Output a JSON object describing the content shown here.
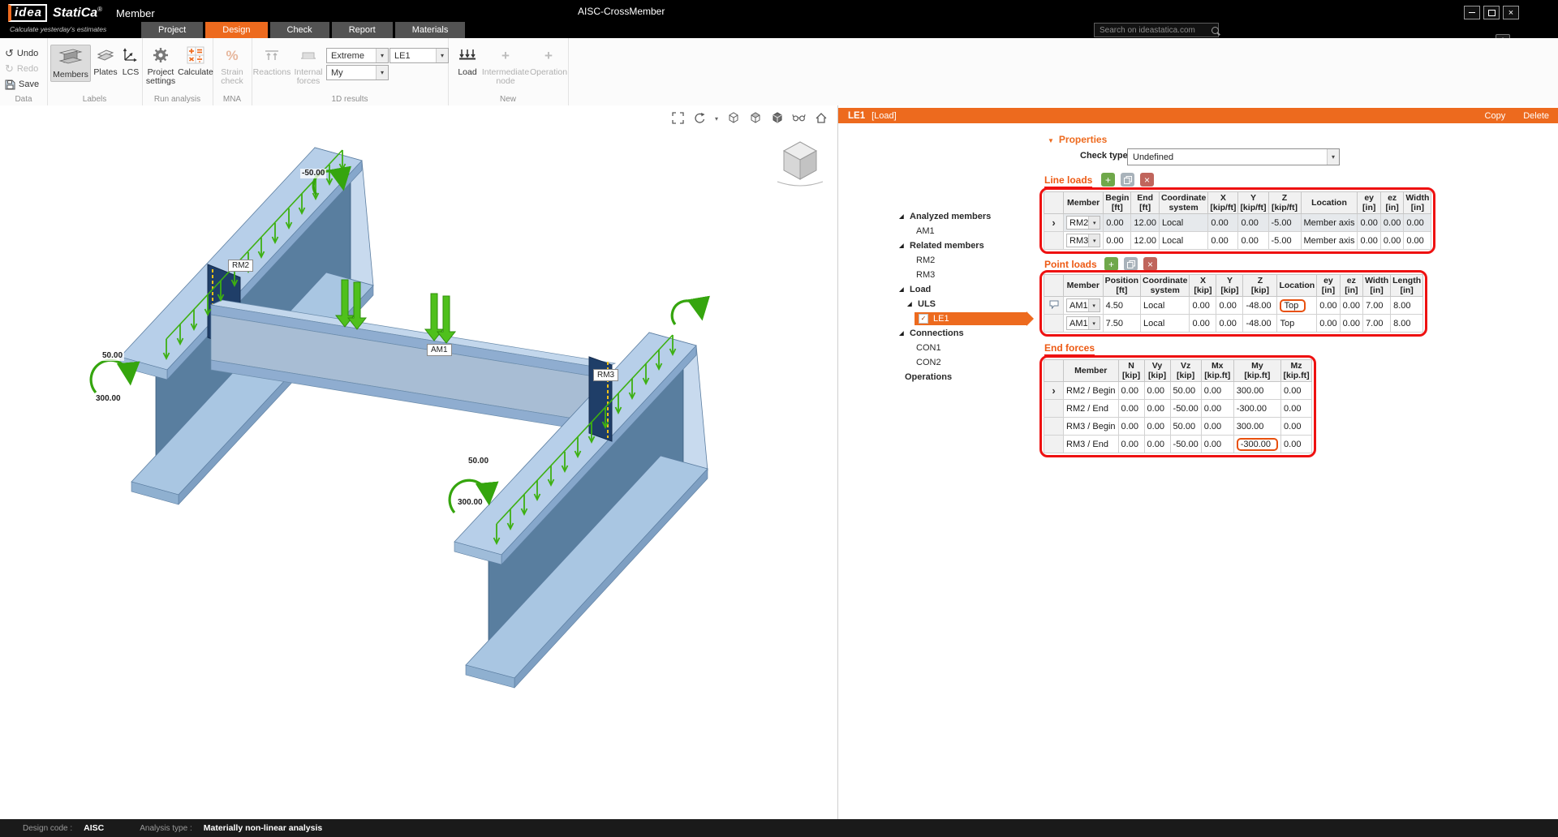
{
  "titlebar": {
    "logo_idea": "idea",
    "logo_statica": "StatiCa",
    "logo_reg": "®",
    "app_name": "Member",
    "tagline": "Calculate yesterday's estimates",
    "document_title": "AISC-CrossMember"
  },
  "tabs": {
    "project": "Project",
    "design": "Design",
    "check": "Check",
    "report": "Report",
    "materials": "Materials"
  },
  "search": {
    "placeholder": "Search on ideastatica.com"
  },
  "ribbon": {
    "undo": "Undo",
    "redo": "Redo",
    "save": "Save",
    "group_data": "Data",
    "members": "Members",
    "plates": "Plates",
    "lcs": "LCS",
    "group_labels": "Labels",
    "project_settings": "Project settings",
    "calculate": "Calculate",
    "group_run": "Run analysis",
    "strain_check": "Strain check",
    "group_mna": "MNA",
    "reactions": "Reactions",
    "internal_forces": "Internal forces",
    "extreme_value": "Extreme",
    "my_value": "My",
    "le1_value": "LE1",
    "group_results": "1D results",
    "load": "Load",
    "intermediate_node": "Intermediate node",
    "operation": "Operation",
    "group_new": "New"
  },
  "viewport": {
    "labels": {
      "rm2": "RM2",
      "rm3": "RM3",
      "am1": "AM1"
    },
    "values": {
      "left_back_moment": "-50.00",
      "left_front_shear": "50.00",
      "left_front_moment": "300.00",
      "right_front_shear": "50.00",
      "right_front_moment": "300.00"
    }
  },
  "tree": {
    "analyzed_members": "Analyzed members",
    "am1": "AM1",
    "related_members": "Related members",
    "rm2": "RM2",
    "rm3": "RM3",
    "load": "Load",
    "uls": "ULS",
    "le1": "LE1",
    "connections": "Connections",
    "con1": "CON1",
    "con2": "CON2",
    "operations": "Operations"
  },
  "panel": {
    "header": {
      "title": "LE1",
      "type": "[Load]",
      "copy": "Copy",
      "delete": "Delete"
    },
    "properties_section": "Properties",
    "check_type": {
      "label": "Check type",
      "value": "Undefined"
    },
    "line_loads": {
      "title": "Line loads",
      "columns": {
        "member": {
          "t": "Member",
          "u": ""
        },
        "begin": {
          "t": "Begin",
          "u": "[ft]"
        },
        "end": {
          "t": "End",
          "u": "[ft]"
        },
        "cs": {
          "t": "Coordinate",
          "u": "system"
        },
        "x": {
          "t": "X",
          "u": "[kip/ft]"
        },
        "y": {
          "t": "Y",
          "u": "[kip/ft]"
        },
        "z": {
          "t": "Z",
          "u": "[kip/ft]"
        },
        "location": {
          "t": "Location",
          "u": ""
        },
        "ey": {
          "t": "ey",
          "u": "[in]"
        },
        "ez": {
          "t": "ez",
          "u": "[in]"
        },
        "width": {
          "t": "Width",
          "u": "[in]"
        }
      },
      "rows": [
        {
          "member": "RM2",
          "begin": "0.00",
          "end": "12.00",
          "cs": "Local",
          "x": "0.00",
          "y": "0.00",
          "z": "-5.00",
          "location": "Member axis",
          "ey": "0.00",
          "ez": "0.00",
          "width": "0.00"
        },
        {
          "member": "RM3",
          "begin": "0.00",
          "end": "12.00",
          "cs": "Local",
          "x": "0.00",
          "y": "0.00",
          "z": "-5.00",
          "location": "Member axis",
          "ey": "0.00",
          "ez": "0.00",
          "width": "0.00"
        }
      ]
    },
    "point_loads": {
      "title": "Point loads",
      "columns": {
        "member": {
          "t": "Member",
          "u": ""
        },
        "position": {
          "t": "Position",
          "u": "[ft]"
        },
        "cs": {
          "t": "Coordinate",
          "u": "system"
        },
        "x": {
          "t": "X",
          "u": "[kip]"
        },
        "y": {
          "t": "Y",
          "u": "[kip]"
        },
        "z": {
          "t": "Z",
          "u": "[kip]"
        },
        "location": {
          "t": "Location",
          "u": ""
        },
        "ey": {
          "t": "ey",
          "u": "[in]"
        },
        "ez": {
          "t": "ez",
          "u": "[in]"
        },
        "width": {
          "t": "Width",
          "u": "[in]"
        },
        "length": {
          "t": "Length",
          "u": "[in]"
        }
      },
      "rows": [
        {
          "member": "AM1",
          "position": "4.50",
          "cs": "Local",
          "x": "0.00",
          "y": "0.00",
          "z": "-48.00",
          "location": "Top",
          "ey": "0.00",
          "ez": "0.00",
          "width": "7.00",
          "length": "8.00"
        },
        {
          "member": "AM1",
          "position": "7.50",
          "cs": "Local",
          "x": "0.00",
          "y": "0.00",
          "z": "-48.00",
          "location": "Top",
          "ey": "0.00",
          "ez": "0.00",
          "width": "7.00",
          "length": "8.00"
        }
      ]
    },
    "end_forces": {
      "title": "End forces",
      "columns": {
        "member": {
          "t": "Member",
          "u": ""
        },
        "n": {
          "t": "N",
          "u": "[kip]"
        },
        "vy": {
          "t": "Vy",
          "u": "[kip]"
        },
        "vz": {
          "t": "Vz",
          "u": "[kip]"
        },
        "mx": {
          "t": "Mx",
          "u": "[kip.ft]"
        },
        "my": {
          "t": "My",
          "u": "[kip.ft]"
        },
        "mz": {
          "t": "Mz",
          "u": "[kip.ft]"
        }
      },
      "rows": [
        {
          "member": "RM2 / Begin",
          "n": "0.00",
          "vy": "0.00",
          "vz": "50.00",
          "mx": "0.00",
          "my": "300.00",
          "mz": "0.00"
        },
        {
          "member": "RM2 / End",
          "n": "0.00",
          "vy": "0.00",
          "vz": "-50.00",
          "mx": "0.00",
          "my": "-300.00",
          "mz": "0.00"
        },
        {
          "member": "RM3 / Begin",
          "n": "0.00",
          "vy": "0.00",
          "vz": "50.00",
          "mx": "0.00",
          "my": "300.00",
          "mz": "0.00"
        },
        {
          "member": "RM3 / End",
          "n": "0.00",
          "vy": "0.00",
          "vz": "-50.00",
          "mx": "0.00",
          "my": "-300.00",
          "mz": "0.00"
        }
      ]
    }
  },
  "statusbar": {
    "design_code_label": "Design code :",
    "design_code_value": "AISC",
    "analysis_type_label": "Analysis type :",
    "analysis_type_value": "Materially non-linear analysis"
  },
  "colors": {
    "accent_orange": "#ED6A1E",
    "annotation_red": "#EE1111",
    "load_green": "#3DB012",
    "steel_flange": "#B7CFE9",
    "steel_web": "#597E9F",
    "plate_navy": "#1F3E68"
  }
}
